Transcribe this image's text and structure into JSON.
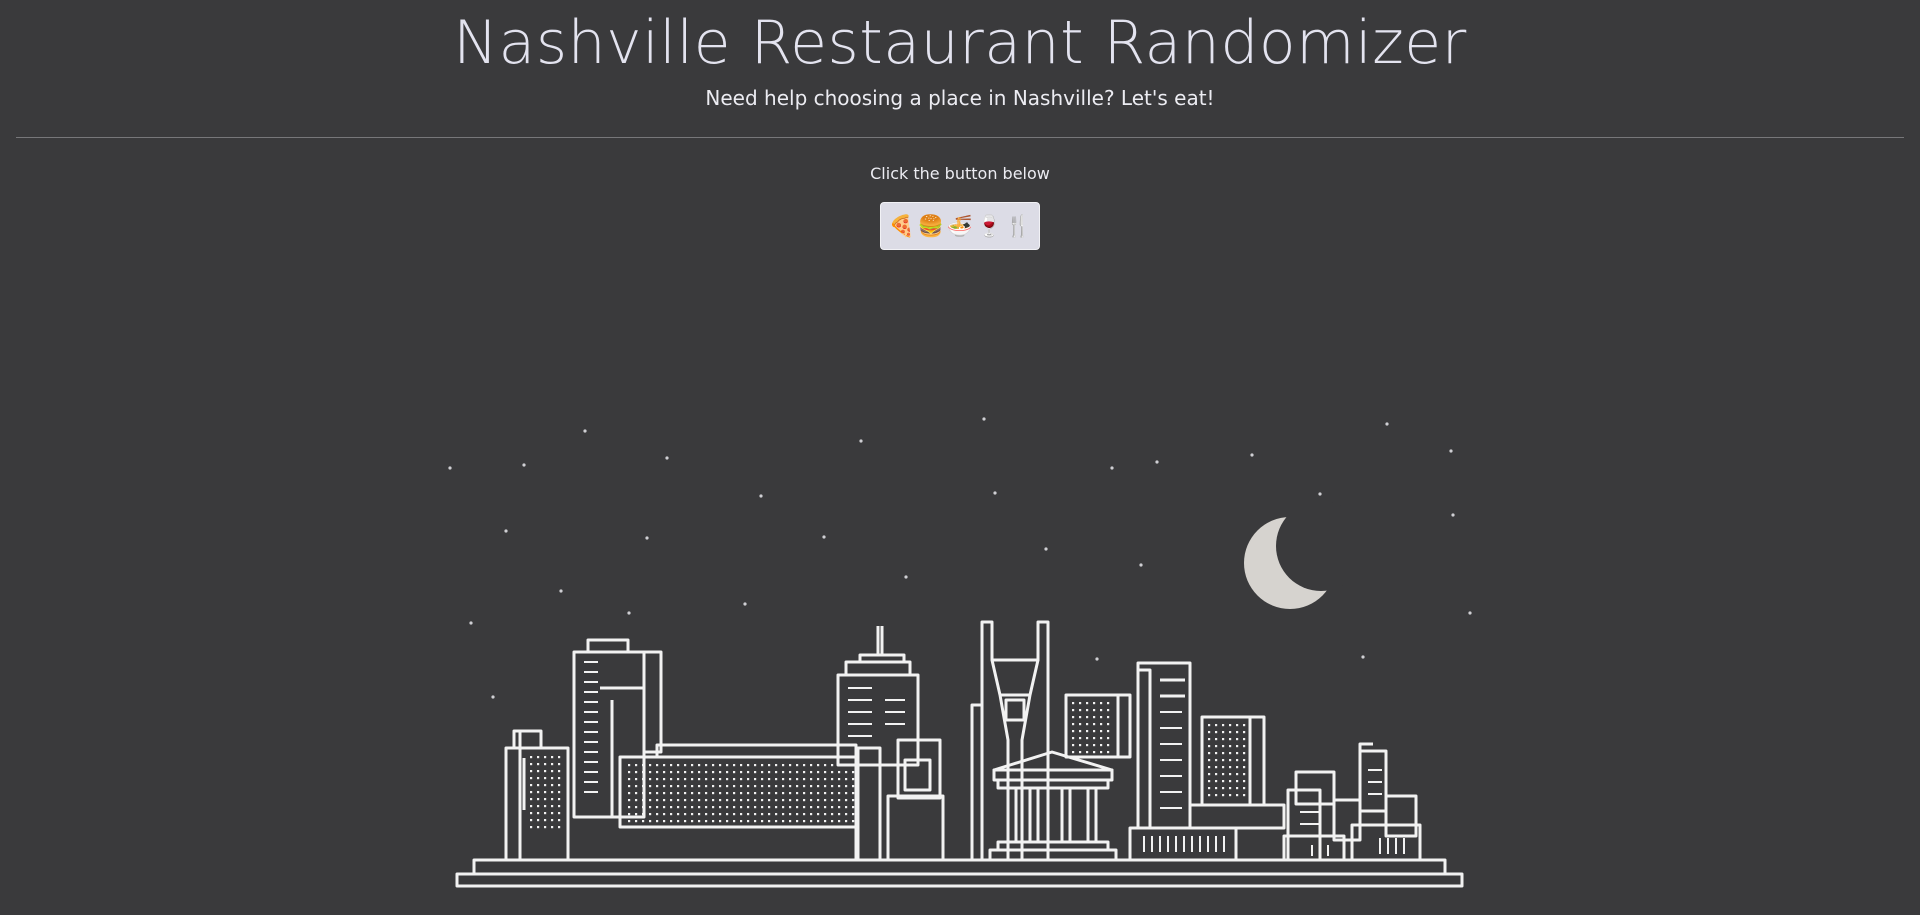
{
  "header": {
    "title": "Nashville Restaurant Randomizer",
    "subtitle": "Need help choosing a place in Nashville? Let's eat!"
  },
  "main": {
    "instruction": "Click the button below",
    "randomize_button": {
      "emojis": [
        "🍕",
        "🍔",
        "🍜",
        "🍷",
        "🍴"
      ]
    }
  },
  "illustration": {
    "subject": "nashville-skyline-at-night",
    "icons": [
      "moon-icon",
      "star-icon",
      "skyline-icon"
    ],
    "colors": {
      "background": "#3a3a3c",
      "line": "#f2f2f2",
      "moon": "#d6d3cf",
      "star": "#cfcfd4"
    }
  }
}
